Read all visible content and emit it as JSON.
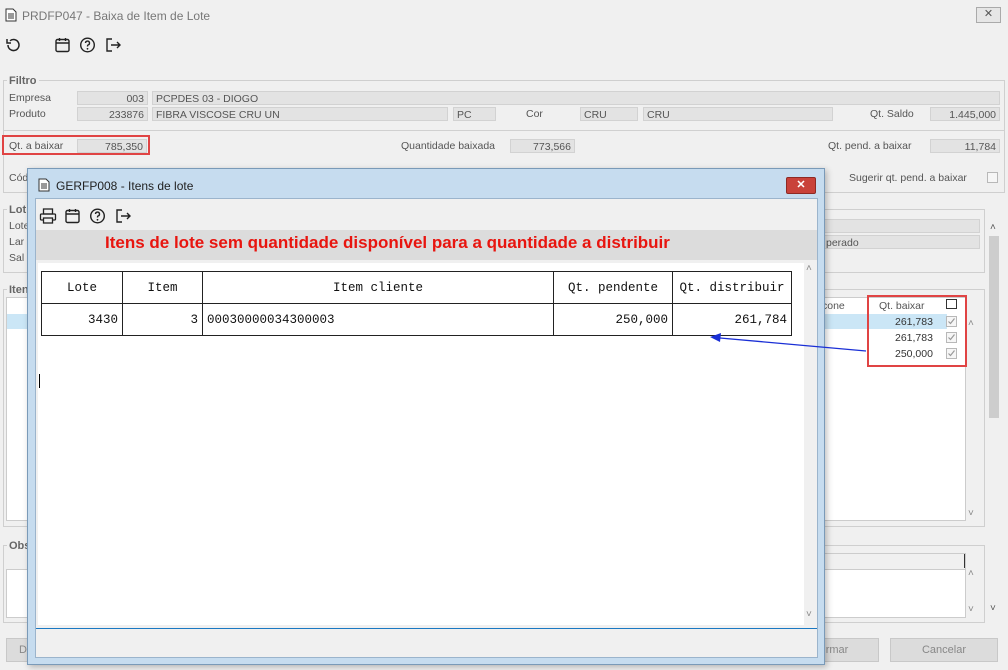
{
  "window": {
    "title": "PRDFP047 - Baixa de Item de Lote"
  },
  "toolbar": {
    "icons": [
      "refresh-icon",
      "calendar-icon",
      "help-icon",
      "exit-icon"
    ]
  },
  "filter": {
    "group_title": "Filtro",
    "empresa_label": "Empresa",
    "empresa_code": "003",
    "empresa_name": "PCPDES 03 - DIOGO",
    "produto_label": "Produto",
    "produto_code": "233876",
    "produto_name": "FIBRA VISCOSE CRU UN",
    "produto_unit": "PC",
    "cor_label": "Cor",
    "cor_code": "CRU",
    "cor_name": "CRU",
    "qt_saldo_label": "Qt. Saldo",
    "qt_saldo_value": "1.445,000",
    "qt_baixar_label": "Qt. a baixar",
    "qt_baixar_value": "785,350",
    "qtd_baixada_label": "Quantidade baixada",
    "qtd_baixada_value": "773,566",
    "qt_pend_label": "Qt. pend. a baixar",
    "qt_pend_value": "11,784",
    "cod_label": "Cód",
    "sugerir_label": "Sugerir qt. pend. a baixar"
  },
  "lote_group": {
    "title": "Lot",
    "row1": "Lote",
    "row2": "Lar",
    "row3": "Sal",
    "side_text": "perado"
  },
  "items_group": {
    "title": "Iten",
    "col_icone": "cone",
    "col_qt_baixar": "Qt. baixar",
    "rows": [
      "261,783",
      "261,783",
      "250,000"
    ]
  },
  "obs_group": {
    "title": "Obs"
  },
  "buttons": {
    "left": "D",
    "confirm": "rmar",
    "cancel": "Cancelar"
  },
  "dialog": {
    "title": "GERFP008 - Itens de lote",
    "icons": [
      "print-icon",
      "calendar-icon",
      "help-icon",
      "exit-icon"
    ],
    "message": "Itens de lote sem quantidade disponível para a quantidade a distribuir",
    "columns": [
      "Lote",
      "Item",
      "Item cliente",
      "Qt. pendente",
      "Qt. distribuir"
    ],
    "rows": [
      {
        "lote": "3430",
        "item": "3",
        "item_cliente": "00030000034300003",
        "qt_pendente": "250,000",
        "qt_distribuir": "261,784"
      }
    ]
  },
  "colors": {
    "annotation_red": "#e04444",
    "arrow_blue": "#1a2fd6",
    "message_red": "#e8150f"
  }
}
